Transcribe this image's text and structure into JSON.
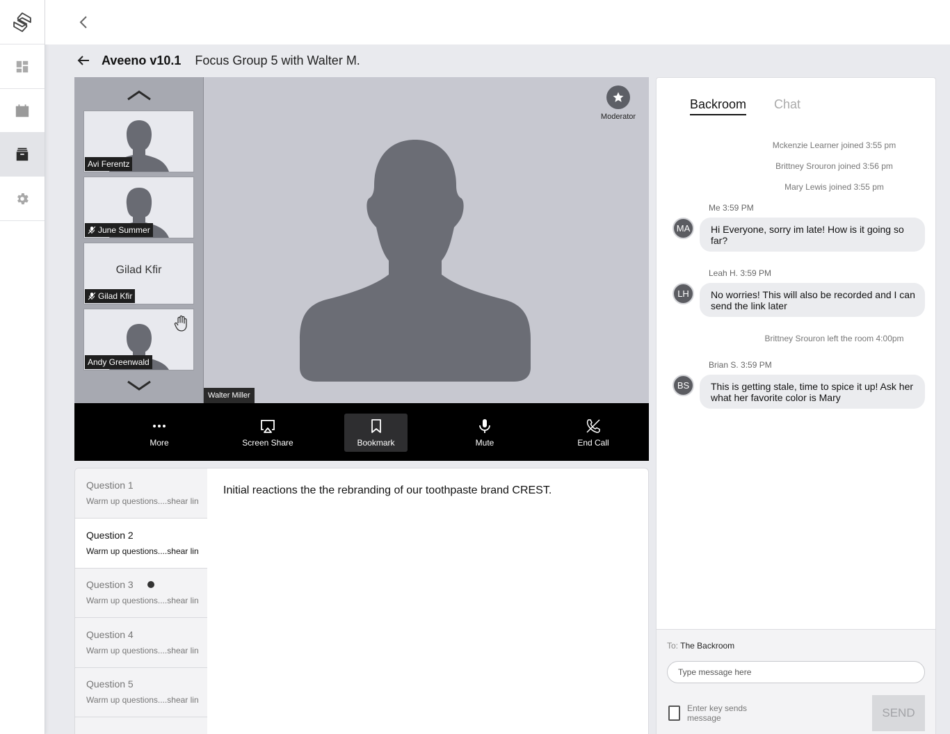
{
  "sidebar": {
    "items": [
      {
        "icon": "logo-icon"
      },
      {
        "icon": "dashboard-icon"
      },
      {
        "icon": "calendar-icon"
      },
      {
        "icon": "archive-icon",
        "active": true
      },
      {
        "icon": "gear-icon"
      }
    ]
  },
  "header": {
    "project": "Aveeno v10.1",
    "session": "Focus Group 5 with Walter M."
  },
  "participants": [
    {
      "name": "Avi Ferentz",
      "muted": false
    },
    {
      "name": "June Summer",
      "muted": true
    },
    {
      "name": "Gilad Kfir",
      "muted": true,
      "center_label": "Gilad Kfir"
    },
    {
      "name": "Andy Greenwald",
      "muted": false,
      "hand_raised": true
    }
  ],
  "main_video": {
    "speaker": "Walter Miller",
    "moderator_label": "Moderator"
  },
  "controls": {
    "more": "More",
    "screen_share": "Screen Share",
    "bookmark": "Bookmark",
    "mute": "Mute",
    "end_call": "End Call"
  },
  "questions": [
    {
      "title": "Question 1",
      "subtitle": "Warm up questions....shear lin"
    },
    {
      "title": "Question 2",
      "subtitle": "Warm up questions....shear lin"
    },
    {
      "title": "Question 3",
      "subtitle": "Warm up questions....shear lin"
    },
    {
      "title": "Question 4",
      "subtitle": "Warm up questions....shear lin"
    },
    {
      "title": "Question 5",
      "subtitle": "Warm up questions....shear lin"
    }
  ],
  "question_text": "Initial reactions the the rebranding of our toothpaste brand CREST.",
  "chat": {
    "tabs": {
      "backroom": "Backroom",
      "chat": "Chat"
    },
    "system": [
      "Mckenzie Learner joined 3:55 pm",
      "Brittney Srouron joined 3:56 pm",
      "Mary Lewis joined 3:55 pm",
      "Brittney Srouron left the room 4:00pm"
    ],
    "messages": [
      {
        "initials": "MA",
        "meta": "Me  3:59 PM",
        "text": "Hi Everyone, sorry im late! How is it going so far?"
      },
      {
        "initials": "LH",
        "meta": "Leah H. 3:59 PM",
        "text": "No worries! This will also be recorded and I can send the link later"
      },
      {
        "initials": "BS",
        "meta": "Brian S.  3:59 PM",
        "text": "This is getting stale, time to spice it up! Ask her what her favorite color is Mary"
      }
    ],
    "to_label": "To:",
    "to_value": "The Backroom",
    "input_placeholder": "Type message here",
    "enter_sends_label": "Enter key sends message",
    "send_label": "SEND"
  },
  "colors": {
    "accent_dark": "#5b5c61",
    "video_bg": "#c7c8d0",
    "silhouette": "#6b6d75"
  }
}
